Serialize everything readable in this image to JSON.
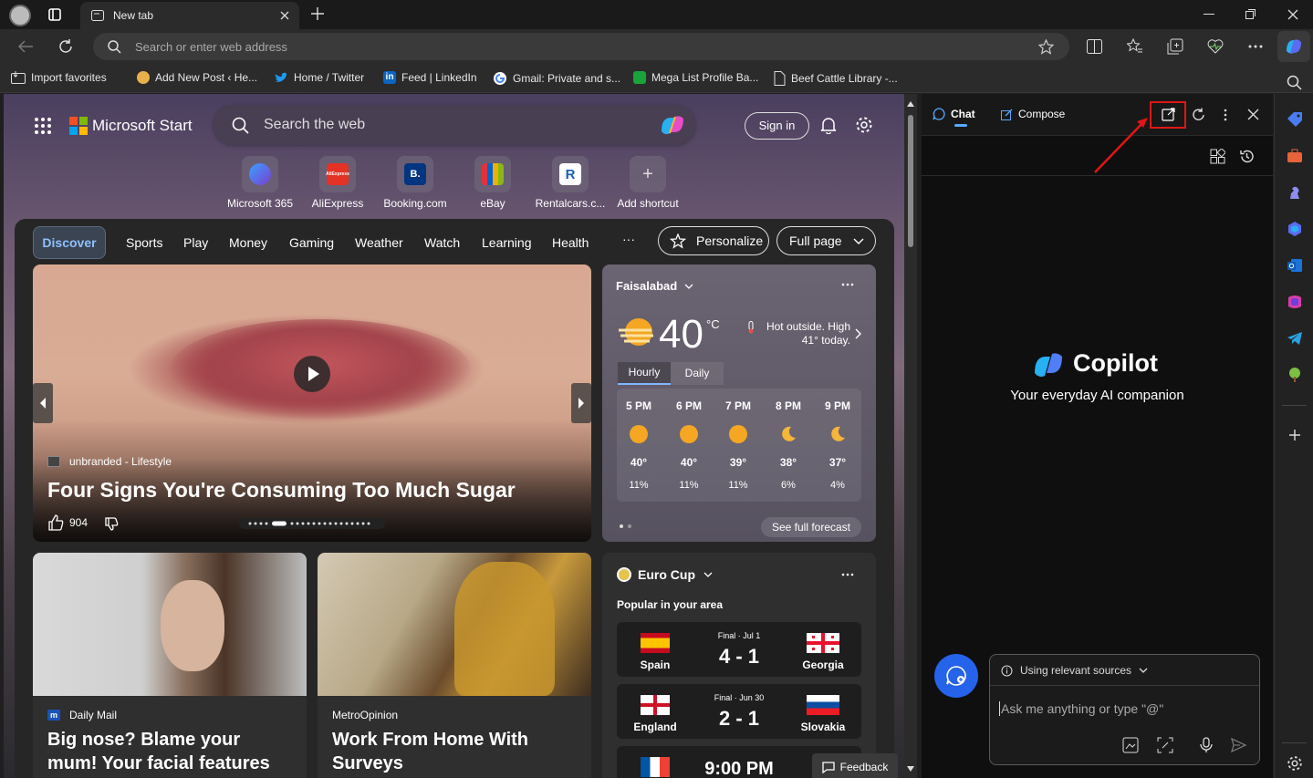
{
  "browser": {
    "tab_title": "New tab",
    "address_placeholder": "Search or enter web address",
    "favorites": [
      {
        "label": "Import favorites"
      },
      {
        "label": "Add New Post ‹ He..."
      },
      {
        "label": "Home / Twitter"
      },
      {
        "label": "Feed | LinkedIn"
      },
      {
        "label": "Gmail: Private and s..."
      },
      {
        "label": "Mega List Profile Ba..."
      },
      {
        "label": "Beef Cattle Library -..."
      }
    ]
  },
  "start": {
    "brand": "Microsoft Start",
    "search_placeholder": "Search the web",
    "sign_in": "Sign in",
    "shortcuts": [
      {
        "label": "Microsoft 365",
        "color": "#5a4fcf",
        "glyph": "365"
      },
      {
        "label": "AliExpress",
        "color": "#e43225",
        "glyph": "AE"
      },
      {
        "label": "Booking.com",
        "color": "#003580",
        "glyph": "B."
      },
      {
        "label": "eBay",
        "color": "#333333",
        "glyph": "e"
      },
      {
        "label": "Rentalcars.c...",
        "color": "#1a5fb4",
        "glyph": "R"
      },
      {
        "label": "Add shortcut",
        "color": "transparent",
        "glyph": "+"
      }
    ],
    "nav": {
      "active": "Discover",
      "items": [
        "Sports",
        "Play",
        "Money",
        "Gaming",
        "Weather",
        "Watch",
        "Learning",
        "Health"
      ],
      "more": "···",
      "personalize": "Personalize",
      "full_page": "Full page"
    },
    "hero": {
      "source": "unbranded - Lifestyle",
      "title": "Four Signs You're Consuming Too Much Sugar",
      "likes": "904"
    },
    "weather": {
      "location": "Faisalabad",
      "temp": "40",
      "unit": "°C",
      "alert": "Hot outside. High 41° today.",
      "tab_hourly": "Hourly",
      "tab_daily": "Daily",
      "hours": [
        {
          "time": "5 PM",
          "temp": "40°",
          "rain": "11%",
          "icon": "sun"
        },
        {
          "time": "6 PM",
          "temp": "40°",
          "rain": "11%",
          "icon": "sun"
        },
        {
          "time": "7 PM",
          "temp": "39°",
          "rain": "11%",
          "icon": "sun"
        },
        {
          "time": "8 PM",
          "temp": "38°",
          "rain": "6%",
          "icon": "moon"
        },
        {
          "time": "9 PM",
          "temp": "37°",
          "rain": "4%",
          "icon": "moon"
        }
      ],
      "see_full": "See full forecast"
    },
    "cards": [
      {
        "source": "Daily Mail",
        "title": "Big nose? Blame your mum! Your facial features may be"
      },
      {
        "source": "MetroOpinion",
        "title": "Work From Home With Surveys"
      }
    ],
    "euro": {
      "title": "Euro Cup",
      "subtitle": "Popular in your area",
      "matches": [
        {
          "status": "Final · Jul 1",
          "score": "4 - 1",
          "home": "Spain",
          "away": "Georgia"
        },
        {
          "status": "Final · Jun 30",
          "score": "2 - 1",
          "home": "England",
          "away": "Slovakia"
        },
        {
          "status": "",
          "score": "9:00 PM",
          "home": "",
          "away": ""
        }
      ]
    },
    "feedback": "Feedback"
  },
  "copilot": {
    "tab_chat": "Chat",
    "tab_compose": "Compose",
    "name": "Copilot",
    "tagline": "Your everyday AI companion",
    "sources": "Using relevant sources",
    "input_placeholder": "Ask me anything or type \"@\""
  }
}
